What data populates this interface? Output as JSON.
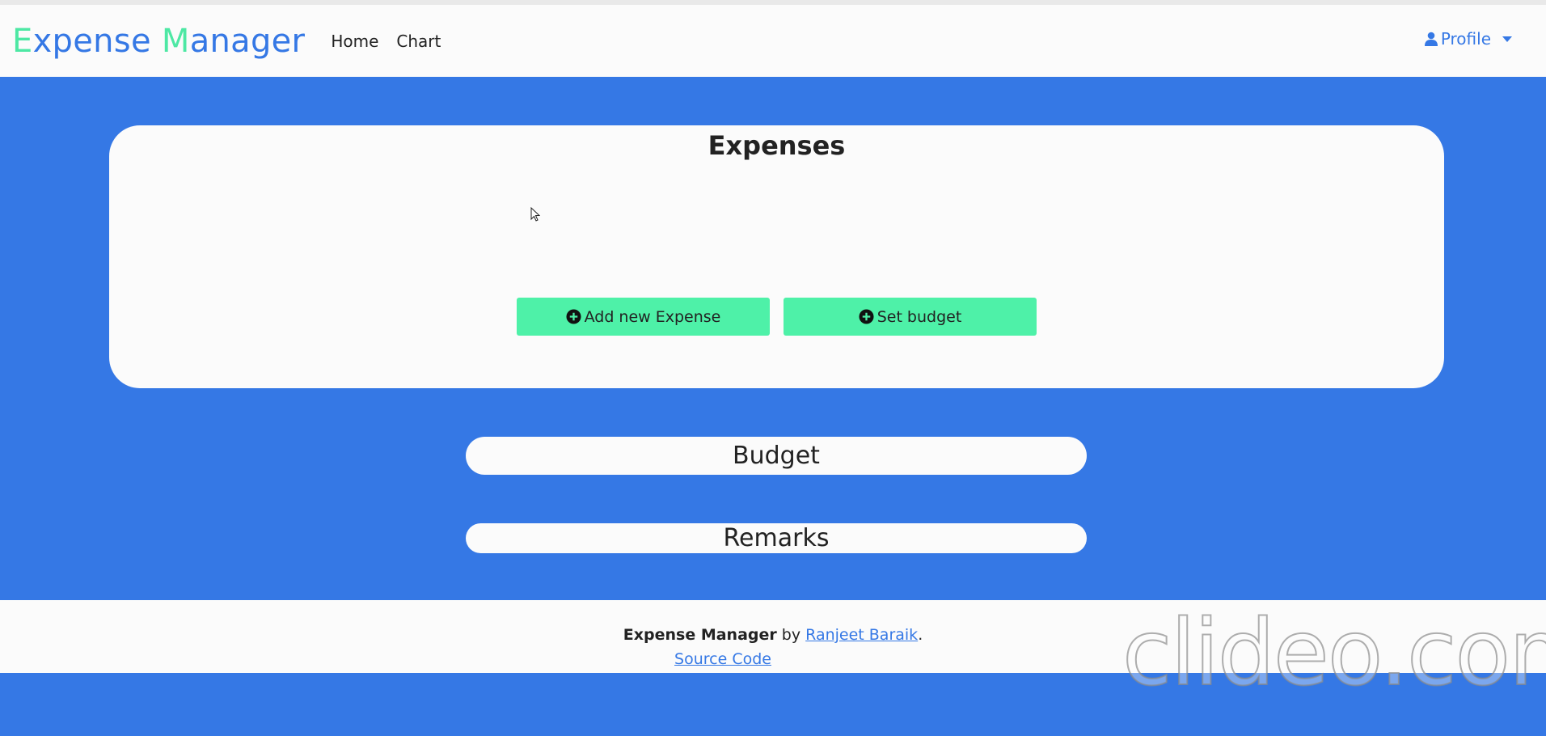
{
  "navbar": {
    "brand": {
      "first_letter": "E",
      "first_rest": "xpense ",
      "second_letter": "M",
      "second_rest": "anager"
    },
    "links": [
      "Home",
      "Chart"
    ],
    "profile_label": "Profile"
  },
  "expenses_card": {
    "title": "Expenses",
    "add_button_label": "Add new Expense",
    "budget_button_label": "Set budget"
  },
  "budget": {
    "title": "Budget"
  },
  "remarks": {
    "title": "Remarks"
  },
  "footer": {
    "app_name": "Expense Manager",
    "by_text": " by ",
    "author": "Ranjeet Baraik",
    "period": ".",
    "source_link": "Source Code"
  },
  "watermark": "clideo.com",
  "colors": {
    "primary": "#3578e5",
    "accent": "#4ef1a8",
    "surface": "#fbfbfb"
  },
  "icons": {
    "profile": "user-icon",
    "add": "plus-circle-icon",
    "budget": "plus-circle-icon"
  }
}
